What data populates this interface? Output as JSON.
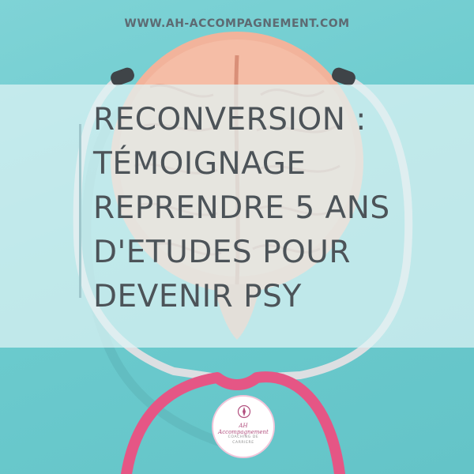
{
  "site_url": "WWW.AH-ACCOMPAGNEMENT.COM",
  "headline_lines": [
    "RECONVERSION :",
    "TÉMOIGNAGE",
    "REPRENDRE 5 ANS",
    "D'ETUDES POUR",
    "DEVENIR PSY"
  ],
  "logo": {
    "name": "AH Accompagnement",
    "tagline_line1": "COACHING DE",
    "tagline_line2": "CARRIERE"
  },
  "colors": {
    "background": "#6ccbce",
    "headline_text": "#4c5358",
    "stethoscope_tube": "#e55685",
    "brain": "#f2b39b",
    "logo_accent": "#b2507f"
  },
  "illustration": {
    "subject": "brain-with-stethoscope"
  }
}
